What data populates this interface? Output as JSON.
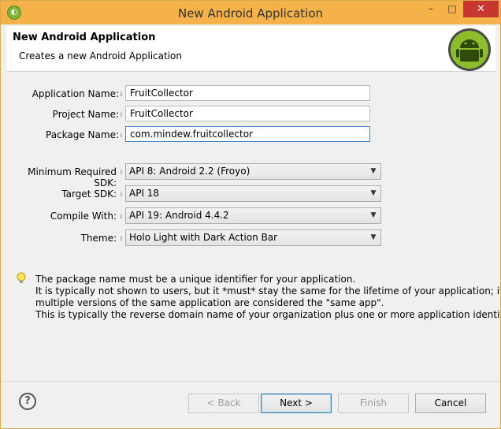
{
  "window": {
    "title": "New Android Application",
    "app_icon": "eclipse-icon",
    "controls": {
      "minimize": "–",
      "maximize": "□",
      "close": "✕"
    }
  },
  "header": {
    "title": "New Android Application",
    "description": "Creates a new Android Application",
    "logo": "android-logo"
  },
  "form": {
    "application_name": {
      "label": "Application Name:",
      "value": "FruitCollector"
    },
    "project_name": {
      "label": "Project Name:",
      "value": "FruitCollector"
    },
    "package_name": {
      "label": "Package Name:",
      "value": "com.mindew.fruitcollector"
    },
    "min_sdk": {
      "label": "Minimum Required SDK:",
      "value": "API 8: Android 2.2 (Froyo)"
    },
    "target_sdk": {
      "label": "Target SDK:",
      "value": "API 18"
    },
    "compile_with": {
      "label": "Compile With:",
      "value": "API 19: Android 4.4.2"
    },
    "theme": {
      "label": "Theme:",
      "value": "Holo Light with Dark Action Bar"
    }
  },
  "info_message": {
    "icon": "lightbulb-icon",
    "lines": [
      "The package name must be a unique identifier for your application.",
      "It is typically not shown to users, but it *must* stay the same for the lifetime of your application; it is how",
      "multiple versions of the same application are considered the \"same app\".",
      "This is typically the reverse domain name of your organization plus one or more application identifiers, and it"
    ]
  },
  "footer": {
    "help": "?",
    "back_label": "< Back",
    "next_label": "Next >",
    "finish_label": "Finish",
    "cancel_label": "Cancel"
  },
  "colors": {
    "title_bar": "#f6b24a",
    "close_button": "#c7372f",
    "focus_border": "#3a83c6",
    "android_green": "#a4c639"
  }
}
